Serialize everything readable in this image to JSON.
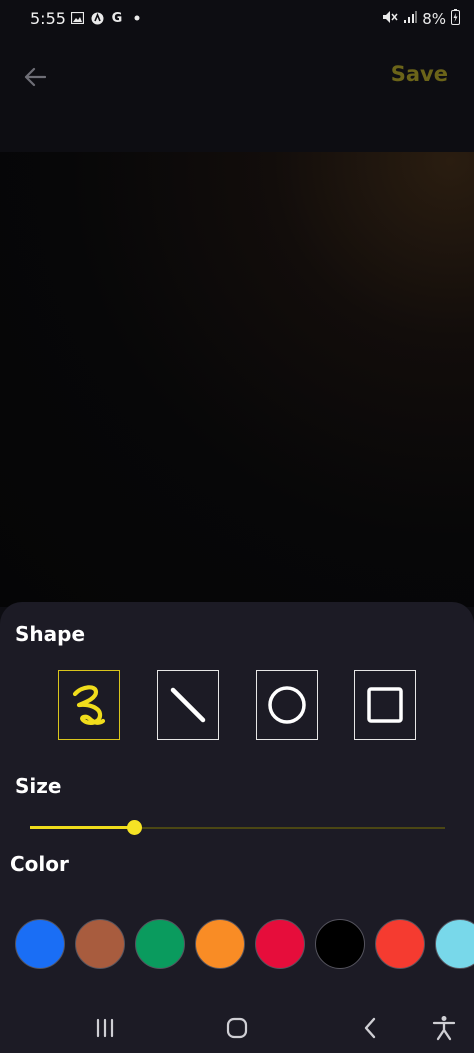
{
  "status_bar": {
    "time": "5:55",
    "left_icons": [
      "image-icon",
      "location-off-icon",
      "google-icon",
      "dot-icon"
    ],
    "google_glyph": "G",
    "battery": "8%"
  },
  "app_bar": {
    "save_label": "Save",
    "save_color": "#6b6419"
  },
  "shape_section": {
    "title": "Shape",
    "options": [
      {
        "name": "freehand",
        "selected": true
      },
      {
        "name": "line",
        "selected": false
      },
      {
        "name": "circle",
        "selected": false
      },
      {
        "name": "square",
        "selected": false
      }
    ],
    "accent_color": "#f0dd1c"
  },
  "size_section": {
    "title": "Size",
    "value_fraction": 0.25
  },
  "color_section": {
    "title": "Color",
    "swatches": [
      "#1a6ef5",
      "#a85c3e",
      "#0a9b5e",
      "#f98c25",
      "#e60d3b",
      "#000000",
      "#f53b30",
      "#78d8ea"
    ]
  },
  "nav_bar": {
    "icons": [
      "recent-apps-icon",
      "home-icon",
      "back-nav-icon",
      "accessibility-icon"
    ]
  }
}
